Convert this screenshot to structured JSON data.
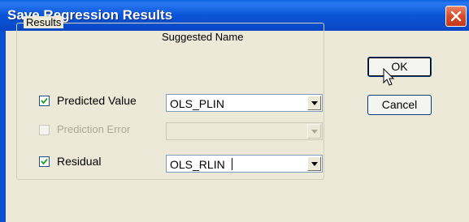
{
  "window": {
    "title": "Save Regression Results"
  },
  "group": {
    "legend": "Results",
    "column_header": "Suggested Name"
  },
  "rows": [
    {
      "label": "Predicted Value",
      "checked": true,
      "enabled": true,
      "value": "OLS_PLIN"
    },
    {
      "label": "Prediction Error",
      "checked": false,
      "enabled": false,
      "value": ""
    },
    {
      "label": "Residual",
      "checked": true,
      "enabled": true,
      "value": "OLS_RLIN"
    }
  ],
  "buttons": {
    "ok": "OK",
    "cancel": "Cancel"
  },
  "colors": {
    "titlebar": "#0a55d8",
    "dialog_bg": "#ece9d8",
    "close": "#d94a2a"
  }
}
